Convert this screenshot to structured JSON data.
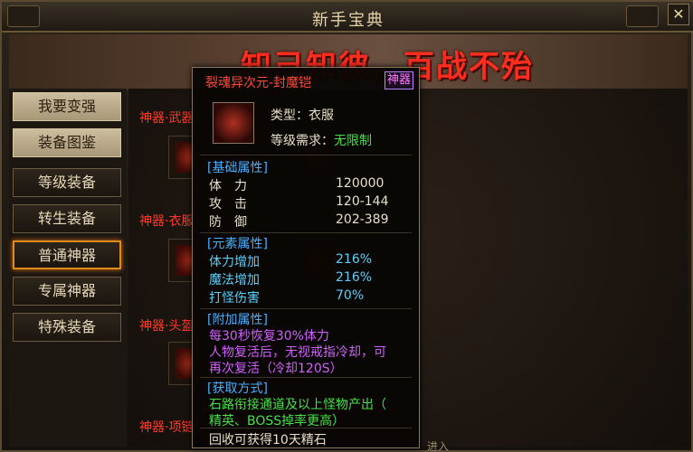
{
  "window": {
    "title": "新手宝典",
    "close_glyph": "✕"
  },
  "banner": {
    "text": "知己知彼，百战不殆"
  },
  "sidebar": {
    "items": [
      {
        "label": "我要变强"
      },
      {
        "label": "装备图鉴"
      },
      {
        "label": "等级装备"
      },
      {
        "label": "转生装备"
      },
      {
        "label": "普通神器"
      },
      {
        "label": "专属神器"
      },
      {
        "label": "特殊装备"
      }
    ]
  },
  "content": {
    "sections": [
      {
        "title": "神器·武器"
      },
      {
        "title": "神器·衣服"
      },
      {
        "title": "神器·头盔"
      },
      {
        "title": "神器·项链"
      }
    ],
    "bottom_text": "进入"
  },
  "tooltip": {
    "name": "裂魂异次元-封魔铠",
    "badge": "神器",
    "type_label": "类型：",
    "type_value": "衣服",
    "level_label": "等级需求：",
    "level_value": "无限制",
    "base_header": "[基础属性]",
    "base_stats": [
      {
        "label": "体　力",
        "value": "120000"
      },
      {
        "label": "攻　击",
        "value": "120-144"
      },
      {
        "label": "防　御",
        "value": "202-389"
      }
    ],
    "element_header": "[元素属性]",
    "element_stats": [
      {
        "label": "体力增加",
        "value": "216%"
      },
      {
        "label": "魔法增加",
        "value": "216%"
      },
      {
        "label": "打怪伤害",
        "value": "70%"
      }
    ],
    "extra_header": "[附加属性]",
    "extra_lines": [
      "每30秒恢复30%体力",
      "人物复活后，无视戒指冷却，可",
      "再次复活（冷却120S）"
    ],
    "source_header": "[获取方式]",
    "source_lines": [
      "石路衔接通道及以上怪物产出（",
      "精英、BOSS掉率更高）"
    ],
    "recycle": "回收可获得10天精石"
  },
  "colors": {
    "accent": "#e08a1a",
    "item_name": "#ff4a3a",
    "header": "#4ab0ff",
    "special": "#d060ff",
    "green": "#48e048"
  }
}
